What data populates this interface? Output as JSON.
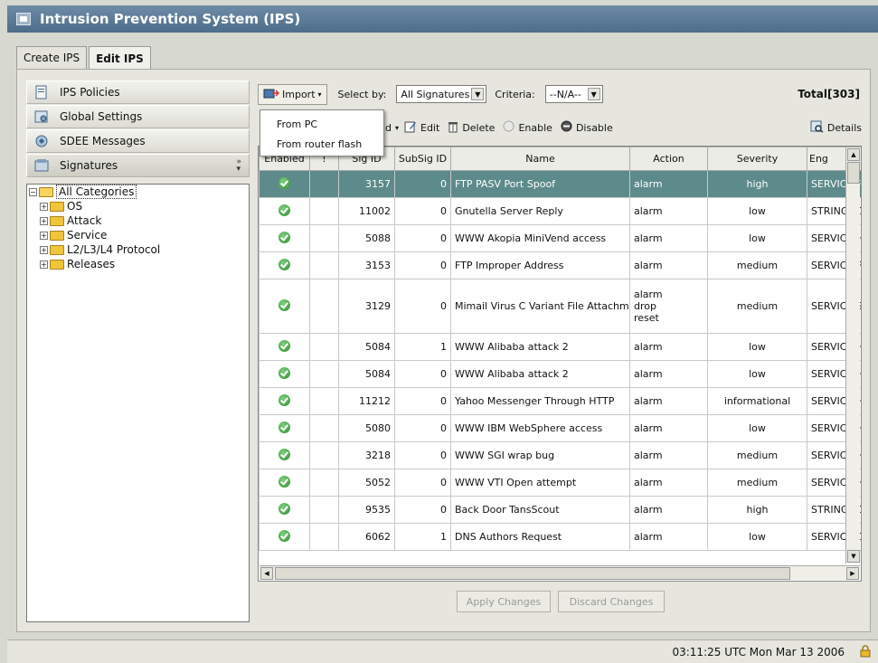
{
  "window": {
    "title": "Intrusion Prevention System (IPS)"
  },
  "tabs": [
    {
      "label": "Create IPS",
      "active": false
    },
    {
      "label": "Edit IPS",
      "active": true
    }
  ],
  "sidebar": {
    "items": [
      {
        "label": "IPS Policies",
        "icon": "policies-icon"
      },
      {
        "label": "Global Settings",
        "icon": "settings-icon"
      },
      {
        "label": "SDEE Messages",
        "icon": "messages-icon"
      },
      {
        "label": "Signatures",
        "icon": "signatures-icon"
      }
    ],
    "tree": {
      "root": "All Categories",
      "children": [
        "OS",
        "Attack",
        "Service",
        "L2/L3/L4 Protocol",
        "Releases"
      ]
    }
  },
  "toolbar": {
    "import_label": "Import",
    "select_by_label": "Select by:",
    "select_by_value": "All Signatures",
    "criteria_label": "Criteria:",
    "criteria_value": "--N/A--",
    "total": "Total[303]",
    "add_fragment": "d",
    "edit_label": "Edit",
    "delete_label": "Delete",
    "enable_label": "Enable",
    "disable_label": "Disable",
    "details_label": "Details"
  },
  "import_menu": {
    "items": [
      "From PC",
      "From router flash"
    ]
  },
  "table": {
    "columns": [
      "Enabled",
      "!",
      "Sig ID",
      "SubSig ID",
      "Name",
      "Action",
      "Severity",
      "Eng"
    ],
    "rows": [
      {
        "sig_id": "3157",
        "subsig": "0",
        "name": "FTP PASV Port Spoof",
        "action": "alarm",
        "severity": "high",
        "engine": "SERVICE.FTP",
        "selected": true
      },
      {
        "sig_id": "11002",
        "subsig": "0",
        "name": "Gnutella Server Reply",
        "action": "alarm",
        "severity": "low",
        "engine": "STRING.TCP"
      },
      {
        "sig_id": "5088",
        "subsig": "0",
        "name": "WWW Akopia MiniVend access",
        "action": "alarm",
        "severity": "low",
        "engine": "SERVICE.HTTP"
      },
      {
        "sig_id": "3153",
        "subsig": "0",
        "name": "FTP Improper Address",
        "action": "alarm",
        "severity": "medium",
        "engine": "SERVICE.FTP"
      },
      {
        "sig_id": "3129",
        "subsig": "0",
        "name": "Mimail Virus C Variant File Attachment",
        "action": "alarm\ndrop\nreset",
        "severity": "medium",
        "engine": "SERVICE.SMTP",
        "tall": true
      },
      {
        "sig_id": "5084",
        "subsig": "1",
        "name": "WWW Alibaba attack 2",
        "action": "alarm",
        "severity": "low",
        "engine": "SERVICE.HTTP"
      },
      {
        "sig_id": "5084",
        "subsig": "0",
        "name": "WWW Alibaba attack 2",
        "action": "alarm",
        "severity": "low",
        "engine": "SERVICE.HTTP"
      },
      {
        "sig_id": "11212",
        "subsig": "0",
        "name": "Yahoo Messenger Through HTTP",
        "action": "alarm",
        "severity": "informational",
        "engine": "SERVICE.HTTP"
      },
      {
        "sig_id": "5080",
        "subsig": "0",
        "name": "WWW IBM WebSphere access",
        "action": "alarm",
        "severity": "low",
        "engine": "SERVICE.HTTP"
      },
      {
        "sig_id": "3218",
        "subsig": "0",
        "name": "WWW SGI wrap bug",
        "action": "alarm",
        "severity": "medium",
        "engine": "SERVICE.HTTP"
      },
      {
        "sig_id": "5052",
        "subsig": "0",
        "name": "WWW VTI Open attempt",
        "action": "alarm",
        "severity": "medium",
        "engine": "SERVICE.HTTP"
      },
      {
        "sig_id": "9535",
        "subsig": "0",
        "name": "Back Door TansScout",
        "action": "alarm",
        "severity": "high",
        "engine": "STRING.TCP"
      },
      {
        "sig_id": "6062",
        "subsig": "1",
        "name": "DNS Authors Request",
        "action": "alarm",
        "severity": "low",
        "engine": "SERVICE.DNS"
      }
    ]
  },
  "buttons": {
    "apply": "Apply Changes",
    "discard": "Discard Changes"
  },
  "status": {
    "time": "03:11:25 UTC Mon Mar 13 2006"
  },
  "colors": {
    "title_bar": "#5a7a98",
    "selected_row": "#5d8a8a",
    "enabled_icon": "#2e8b2e"
  }
}
